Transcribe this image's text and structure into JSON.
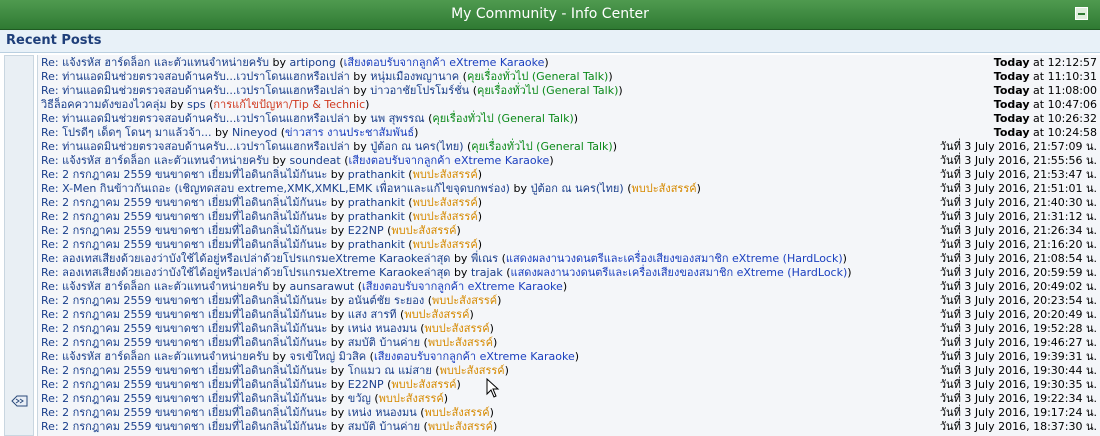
{
  "window": {
    "title": "My Community - Info Center"
  },
  "section": {
    "title": "Recent Posts"
  },
  "colors": {
    "header": "#2f7a33",
    "link": "#1a3f8c",
    "board_blue": "#1a3fbf",
    "board_green": "#0b8a1a",
    "board_red": "#d03a20",
    "board_orange": "#d68a00"
  },
  "posts": [
    {
      "title": "Re: แจ้งรหัส ฮาร์ดล็อก และตัวแทนจำหน่ายครับ",
      "by": "by",
      "user": "artipong",
      "board": "เสียงตอบรับจากลูกค้า eXtreme Karaoke",
      "color": "blue",
      "day": "Today",
      "time": "at 12:12:57"
    },
    {
      "title": "Re: ท่านแอดมินช่วยตรวจสอบด้านครับ...เวปราโดนแฮกหรือเปล่า",
      "by": "by",
      "user": "หนุ่มเมืองพญานาค",
      "board": "คุยเรื่องทั่วไป (General Talk)",
      "color": "green",
      "day": "Today",
      "time": "at 11:10:31"
    },
    {
      "title": "Re: ท่านแอดมินช่วยตรวจสอบด้านครับ...เวปราโดนแฮกหรือเปล่า",
      "by": "by",
      "user": "บ่าวอาชัยโปรโมร์ชั่น",
      "board": "คุยเรื่องทั่วไป (General Talk)",
      "color": "green",
      "day": "Today",
      "time": "at 11:08:00"
    },
    {
      "title": "วิธีล็อคความดังของไวคลุ่ม",
      "by": "by",
      "user": "sps",
      "board": "การแก้ไขปัญหา/Tip & Technic",
      "color": "red",
      "day": "Today",
      "time": "at 10:47:06"
    },
    {
      "title": "Re: ท่านแอดมินช่วยตรวจสอบด้านครับ...เวปราโดนแฮกหรือเปล่า",
      "by": "by",
      "user": "นพ สุพรรณ",
      "board": "คุยเรื่องทั่วไป (General Talk)",
      "color": "green",
      "day": "Today",
      "time": "at 10:26:32"
    },
    {
      "title": "Re: โปรดีๆ เด็ดๆ โดนๆ มาแล้วจ้า...",
      "by": "by",
      "user": "Nineyod",
      "board": "ข่าวสาร งานประชาสัมพันธ์",
      "color": "blue",
      "day": "Today",
      "time": "at 10:24:58"
    },
    {
      "title": "Re: ท่านแอดมินช่วยตรวจสอบด้านครับ...เวปราโดนแฮกหรือเปล่า",
      "by": "by",
      "user": "ปู่ต้อก ณ นคร(ไทย)",
      "board": "คุยเรื่องทั่วไป (General Talk)",
      "color": "green",
      "day": "",
      "time": "วันที่ 3 July 2016, 21:57:09 น."
    },
    {
      "title": "Re: แจ้งรหัส ฮาร์ดล็อก และตัวแทนจำหน่ายครับ",
      "by": "by",
      "user": "soundeat",
      "board": "เสียงตอบรับจากลูกค้า eXtreme Karaoke",
      "color": "blue",
      "day": "",
      "time": "วันที่ 3 July 2016, 21:55:56 น."
    },
    {
      "title": "Re: 2 กรกฎาคม 2559 ขนขาดชา เยี่ยมที่ไอดินกลิ่นไม้กันนะ",
      "by": "by",
      "user": "prathankit",
      "board": "พบปะสังสรรค์",
      "color": "orange",
      "day": "",
      "time": "วันที่ 3 July 2016, 21:53:47 น."
    },
    {
      "title": "Re: X-Men กินข้าวกันเถอะ (เชิญทดสอบ extreme,XMK,XMKL,EMK เพื่อหาและแก้ไขจุดบกพร่อง)",
      "by": "by",
      "user": "ปู่ต้อก ณ นคร(ไทย)",
      "board": "พบปะสังสรรค์",
      "color": "orange",
      "day": "",
      "time": "วันที่ 3 July 2016, 21:51:01 น."
    },
    {
      "title": "Re: 2 กรกฎาคม 2559 ขนขาดชา เยี่ยมที่ไอดินกลิ่นไม้กันนะ",
      "by": "by",
      "user": "prathankit",
      "board": "พบปะสังสรรค์",
      "color": "orange",
      "day": "",
      "time": "วันที่ 3 July 2016, 21:40:30 น."
    },
    {
      "title": "Re: 2 กรกฎาคม 2559 ขนขาดชา เยี่ยมที่ไอดินกลิ่นไม้กันนะ",
      "by": "by",
      "user": "prathankit",
      "board": "พบปะสังสรรค์",
      "color": "orange",
      "day": "",
      "time": "วันที่ 3 July 2016, 21:31:12 น."
    },
    {
      "title": "Re: 2 กรกฎาคม 2559 ขนขาดชา เยี่ยมที่ไอดินกลิ่นไม้กันนะ",
      "by": "by",
      "user": "E22NP",
      "board": "พบปะสังสรรค์",
      "color": "orange",
      "day": "",
      "time": "วันที่ 3 July 2016, 21:26:34 น."
    },
    {
      "title": "Re: 2 กรกฎาคม 2559 ขนขาดชา เยี่ยมที่ไอดินกลิ่นไม้กันนะ",
      "by": "by",
      "user": "prathankit",
      "board": "พบปะสังสรรค์",
      "color": "orange",
      "day": "",
      "time": "วันที่ 3 July 2016, 21:16:20 น."
    },
    {
      "title": "Re: ลองเทสเสียงด้วยเองว่าบังใช้ได้อยู่หรือเปล่าด้วยโปรแกรมeXtreme Karaokeล่าสุด",
      "by": "by",
      "user": "พี่เณร",
      "board": "แสดงผลงานวงดนตรีและเครื่องเสียงของสมาชิก eXtreme (HardLock)",
      "color": "blue",
      "day": "",
      "time": "วันที่ 3 July 2016, 21:08:54 น."
    },
    {
      "title": "Re: ลองเทสเสียงด้วยเองว่าบังใช้ได้อยู่หรือเปล่าด้วยโปรแกรมeXtreme Karaokeล่าสุด",
      "by": "by",
      "user": "trajak",
      "board": "แสดงผลงานวงดนตรีและเครื่องเสียงของสมาชิก eXtreme (HardLock)",
      "color": "blue",
      "day": "",
      "time": "วันที่ 3 July 2016, 20:59:59 น."
    },
    {
      "title": "Re: แจ้งรหัส ฮาร์ดล็อก และตัวแทนจำหน่ายครับ",
      "by": "by",
      "user": "aunsarawut",
      "board": "เสียงตอบรับจากลูกค้า eXtreme Karaoke",
      "color": "blue",
      "day": "",
      "time": "วันที่ 3 July 2016, 20:49:02 น."
    },
    {
      "title": "Re: 2 กรกฎาคม 2559 ขนขาดชา เยี่ยมที่ไอดินกลิ่นไม้กันนะ",
      "by": "by",
      "user": "อนันต์ชัย ระยอง",
      "board": "พบปะสังสรรค์",
      "color": "orange",
      "day": "",
      "time": "วันที่ 3 July 2016, 20:23:54 น."
    },
    {
      "title": "Re: 2 กรกฎาคม 2559 ขนขาดชา เยี่ยมที่ไอดินกลิ่นไม้กันนะ",
      "by": "by",
      "user": "แสง สารที",
      "board": "พบปะสังสรรค์",
      "color": "orange",
      "day": "",
      "time": "วันที่ 3 July 2016, 20:20:49 น."
    },
    {
      "title": "Re: 2 กรกฎาคม 2559 ขนขาดชา เยี่ยมที่ไอดินกลิ่นไม้กันนะ",
      "by": "by",
      "user": "เหน่ง หนองมน",
      "board": "พบปะสังสรรค์",
      "color": "orange",
      "day": "",
      "time": "วันที่ 3 July 2016, 19:52:28 น."
    },
    {
      "title": "Re: 2 กรกฎาคม 2559 ขนขาดชา เยี่ยมที่ไอดินกลิ่นไม้กันนะ",
      "by": "by",
      "user": "สมบัติ บ้านค่าย",
      "board": "พบปะสังสรรค์",
      "color": "orange",
      "day": "",
      "time": "วันที่ 3 July 2016, 19:46:27 น."
    },
    {
      "title": "Re: แจ้งรหัส ฮาร์ดล็อก และตัวแทนจำหน่ายครับ",
      "by": "by",
      "user": "จรเข้ใหญ่ มิวสิค",
      "board": "เสียงตอบรับจากลูกค้า eXtreme Karaoke",
      "color": "blue",
      "day": "",
      "time": "วันที่ 3 July 2016, 19:39:31 น."
    },
    {
      "title": "Re: 2 กรกฎาคม 2559 ขนขาดชา เยี่ยมที่ไอดินกลิ่นไม้กันนะ",
      "by": "by",
      "user": "โกแมว ณ แม่สาย",
      "board": "พบปะสังสรรค์",
      "color": "orange",
      "day": "",
      "time": "วันที่ 3 July 2016, 19:30:44 น."
    },
    {
      "title": "Re: 2 กรกฎาคม 2559 ขนขาดชา เยี่ยมที่ไอดินกลิ่นไม้กันนะ",
      "by": "by",
      "user": "E22NP",
      "board": "พบปะสังสรรค์",
      "color": "orange",
      "day": "",
      "time": "วันที่ 3 July 2016, 19:30:35 น."
    },
    {
      "title": "Re: 2 กรกฎาคม 2559 ขนขาดชา เยี่ยมที่ไอดินกลิ่นไม้กันนะ",
      "by": "by",
      "user": "ขวัญ",
      "board": "พบปะสังสรรค์",
      "color": "orange",
      "day": "",
      "time": "วันที่ 3 July 2016, 19:22:34 น."
    },
    {
      "title": "Re: 2 กรกฎาคม 2559 ขนขาดชา เยี่ยมที่ไอดินกลิ่นไม้กันนะ",
      "by": "by",
      "user": "เหน่ง หนองมน",
      "board": "พบปะสังสรรค์",
      "color": "orange",
      "day": "",
      "time": "วันที่ 3 July 2016, 19:17:24 น."
    },
    {
      "title": "Re: 2 กรกฎาคม 2559 ขนขาดชา เยี่ยมที่ไอดินกลิ่นไม้กันนะ",
      "by": "by",
      "user": "สมบัติ บ้านค่าย",
      "board": "พบปะสังสรรค์",
      "color": "orange",
      "day": "",
      "time": "วันที่ 3 July 2016, 18:37:30 น."
    }
  ]
}
